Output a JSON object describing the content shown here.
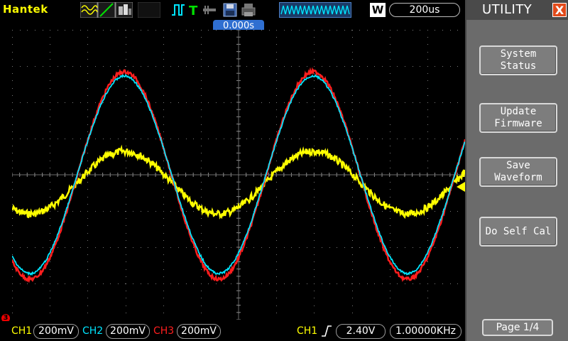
{
  "brand": "Hantek",
  "topbar": {
    "display_icons": [
      "sine-wave-icon",
      "ramp-icon",
      "persist-icon"
    ],
    "trigger_mode_icons": [
      "pulse-icon",
      "trigger-t-icon",
      "probe-icon",
      "save-disk-icon",
      "print-icon"
    ],
    "acquire_label": "W",
    "timebase": "200us",
    "colors": {
      "yellow": "#ffff00",
      "cyan": "#00e5ff",
      "red": "#ff1e1e",
      "blue": "#2f6fd1"
    }
  },
  "display": {
    "trigger_position": "0.000s"
  },
  "bottombar": {
    "ref_marker": "3",
    "ch1_label": "CH1",
    "ch1_scale": "200mV",
    "ch2_label": "CH2",
    "ch2_scale": "200mV",
    "ch3_label": "CH3",
    "ch3_scale": "200mV",
    "trig_source": "CH1",
    "trig_edge_icon": "rising-edge-icon",
    "trig_level": "2.40V",
    "frequency": "1.00000KHz"
  },
  "menu": {
    "title": "UTILITY",
    "close_label": "X",
    "buttons": [
      {
        "line1": "System",
        "line2": "Status"
      },
      {
        "line1": "Update",
        "line2": "Firmware"
      },
      {
        "line1": "Save",
        "line2": "Waveform"
      },
      {
        "line1": "Do Self Cal",
        "line2": ""
      }
    ],
    "page": "Page 1/4"
  }
}
